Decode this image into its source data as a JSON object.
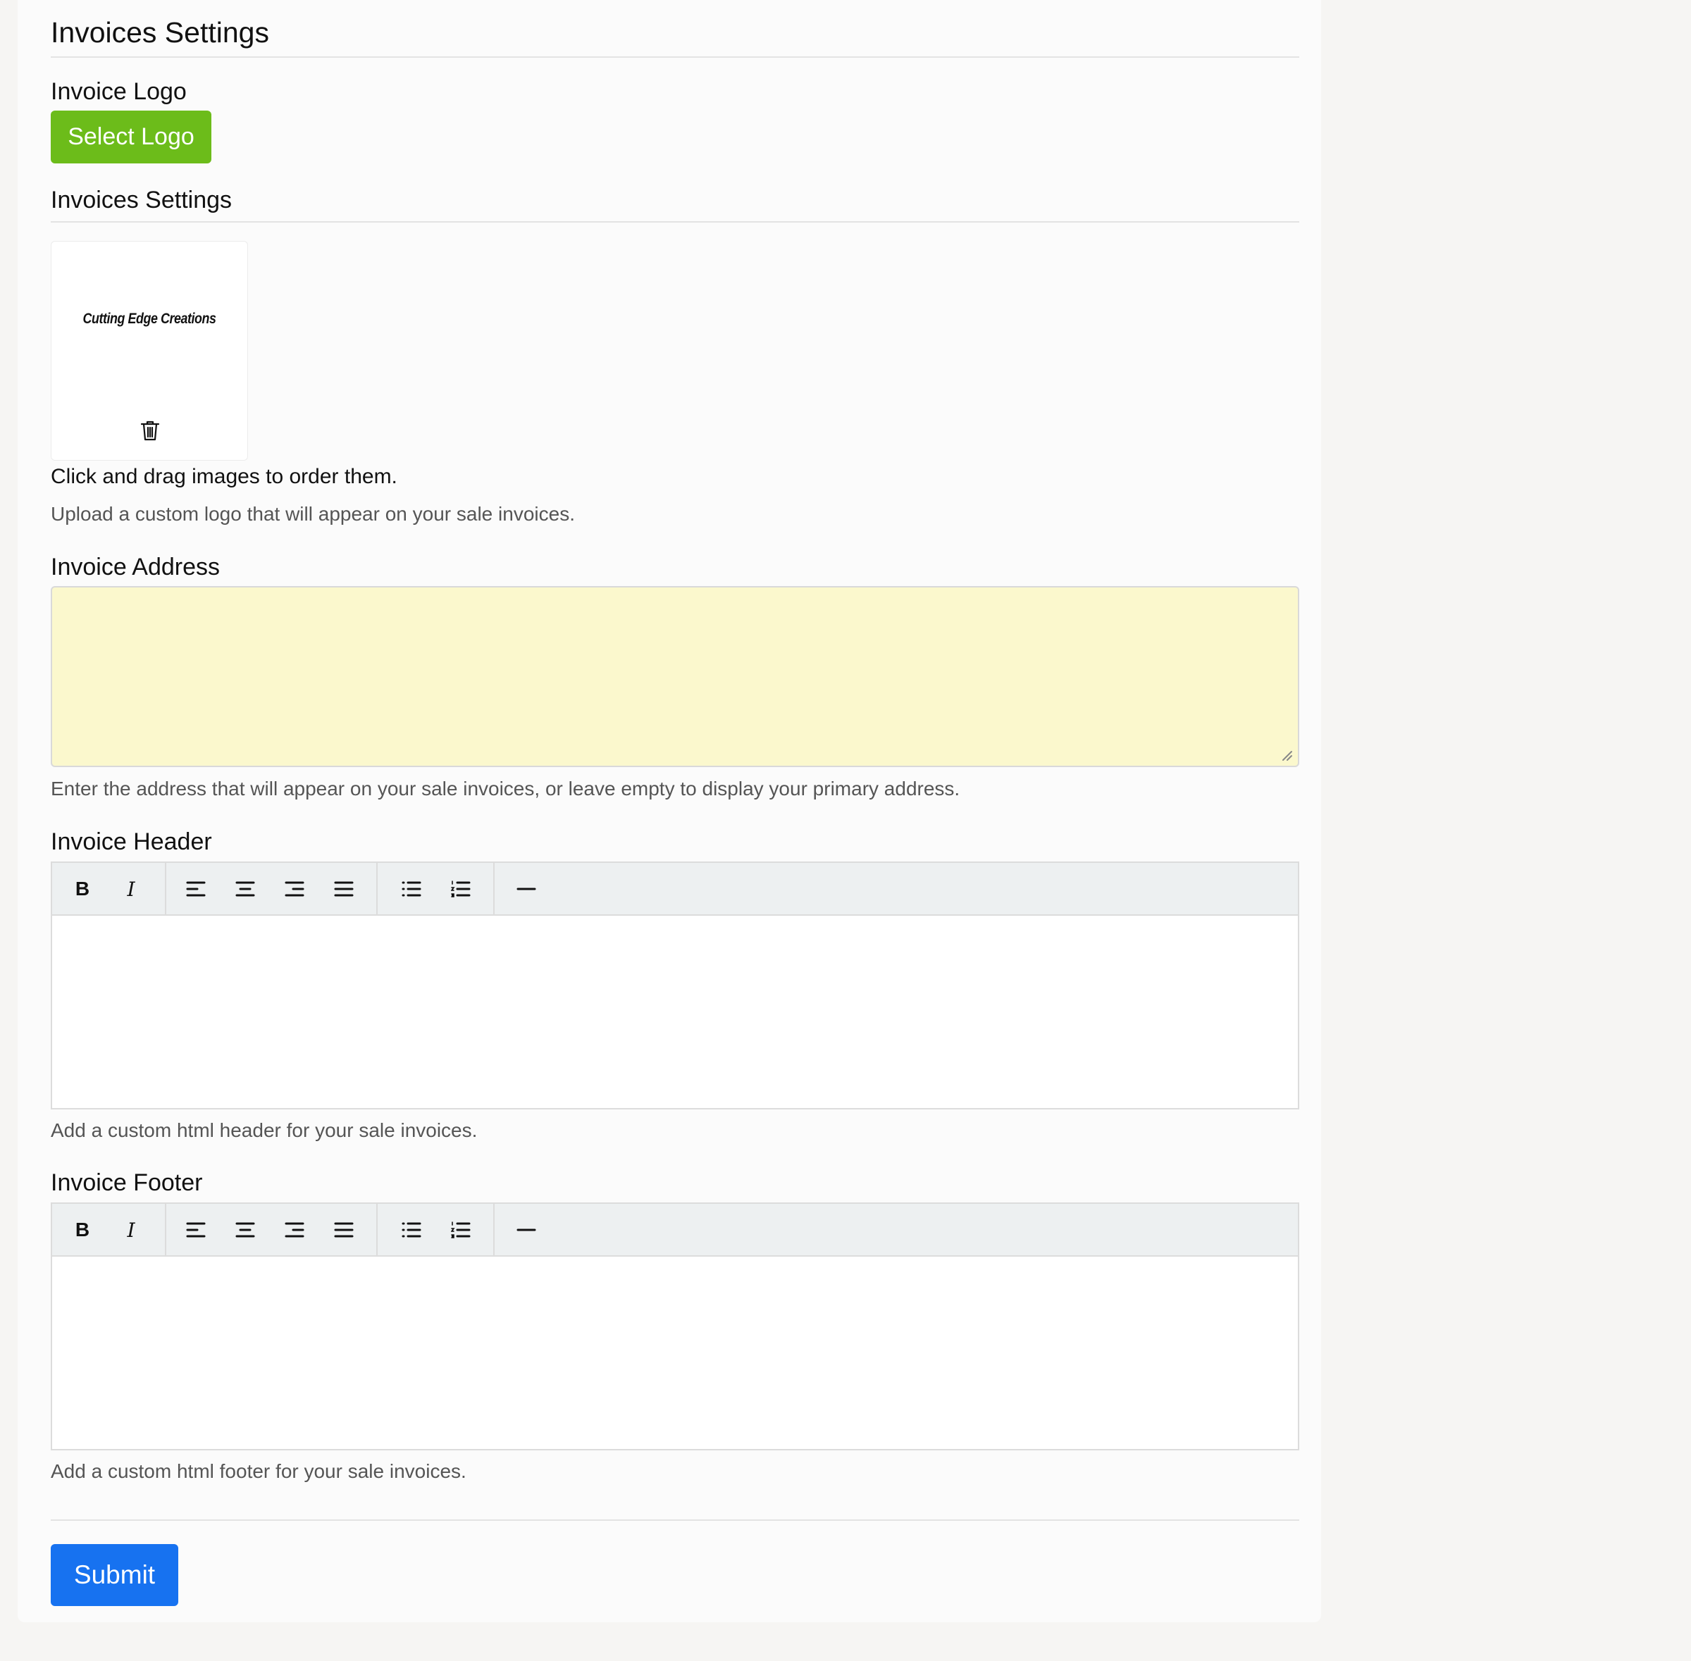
{
  "page": {
    "title": "Invoices Settings"
  },
  "logo_section": {
    "label": "Invoice Logo",
    "select_button": "Select Logo",
    "subheading": "Invoices Settings",
    "thumbnail_text": "Cutting Edge Creations",
    "delete_icon": "trash-icon",
    "drag_note": "Click and drag images to order them.",
    "help": "Upload a custom logo that will appear on your sale invoices."
  },
  "address_section": {
    "label": "Invoice Address",
    "value": "",
    "placeholder": "",
    "background_color": "#fbf8cd",
    "help": "Enter the address that will appear on your sale invoices, or leave empty to display your primary address."
  },
  "header_section": {
    "label": "Invoice Header",
    "toolbar": {
      "bold": "B",
      "italic": "I"
    },
    "help": "Add a custom html header for your sale invoices."
  },
  "footer_section": {
    "label": "Invoice Footer",
    "toolbar": {
      "bold": "B",
      "italic": "I"
    },
    "help": "Add a custom html footer for your sale invoices."
  },
  "actions": {
    "submit": "Submit"
  },
  "colors": {
    "select_logo_button": "#6cbc1a",
    "submit_button": "#1772f0",
    "toolbar_bg": "#edf0f1",
    "page_bg": "#f6f5f3"
  }
}
